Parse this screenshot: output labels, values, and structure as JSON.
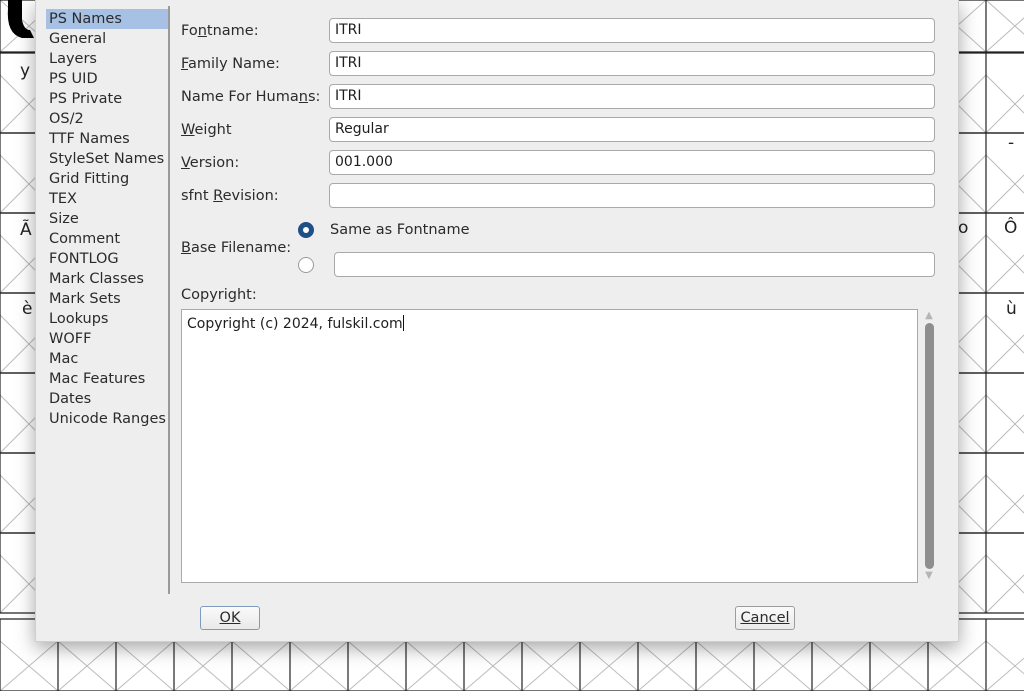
{
  "background": {
    "glyphs": [
      "y",
      "Ã",
      "ô",
      "è",
      "ù",
      "Ô",
      "-",
      "o"
    ]
  },
  "dialog": {
    "sidebar": {
      "items": [
        "PS Names",
        "General",
        "Layers",
        "PS UID",
        "PS Private",
        "OS/2",
        "TTF Names",
        "StyleSet Names",
        "Grid Fitting",
        "TEX",
        "Size",
        "Comment",
        "FONTLOG",
        "Mark Classes",
        "Mark Sets",
        "Lookups",
        "WOFF",
        "Mac",
        "Mac Features",
        "Dates",
        "Unicode Ranges"
      ],
      "selected": "PS Names"
    },
    "fields": {
      "fontname": {
        "label_pre": "Fo",
        "label_u": "n",
        "label_post": "tname:",
        "value": "ITRI"
      },
      "family_name": {
        "label_pre": "",
        "label_u": "F",
        "label_post": "amily Name:",
        "value": "ITRI"
      },
      "name_for_humans": {
        "label_pre": "Name For Huma",
        "label_u": "n",
        "label_post": "s:",
        "value": "ITRI"
      },
      "weight": {
        "label_pre": "",
        "label_u": "W",
        "label_post": "eight",
        "value": "Regular"
      },
      "version": {
        "label_pre": "",
        "label_u": "V",
        "label_post": "ersion:",
        "value": "001.000"
      },
      "sfnt_revision": {
        "label_pre": "sfnt ",
        "label_u": "R",
        "label_post": "evision:",
        "value": ""
      }
    },
    "base_filename": {
      "label_pre": "",
      "label_u": "B",
      "label_post": "ase Filename:",
      "option_same": "Same as Fontname",
      "custom_value": ""
    },
    "copyright": {
      "label": "Copyright:",
      "value": "Copyright (c) 2024, fulskil.com"
    },
    "buttons": {
      "ok": "OK",
      "cancel": "Cancel"
    }
  }
}
